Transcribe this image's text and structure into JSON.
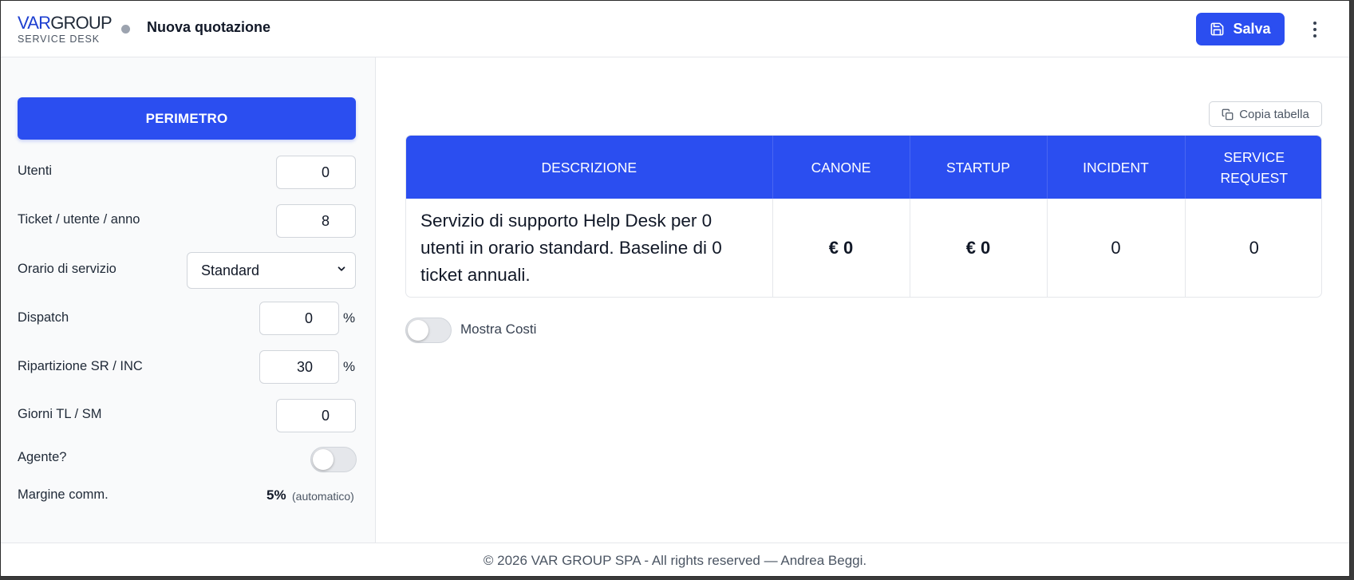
{
  "header": {
    "logo_var": "VAR",
    "logo_group": "GROUP",
    "logo_sub": "SERVICE DESK",
    "title": "Nuova quotazione",
    "save_label": "Salva"
  },
  "sidebar": {
    "section_button": "PERIMETRO",
    "fields": {
      "utenti": {
        "label": "Utenti",
        "value": "0"
      },
      "ticket": {
        "label": "Ticket / utente / anno",
        "value": "8"
      },
      "orario": {
        "label": "Orario di servizio",
        "value": "Standard"
      },
      "dispatch": {
        "label": "Dispatch",
        "value": "0",
        "unit": "%"
      },
      "ripartizione": {
        "label": "Ripartizione SR / INC",
        "value": "30",
        "unit": "%"
      },
      "giorni": {
        "label": "Giorni TL / SM",
        "value": "0"
      },
      "agente": {
        "label": "Agente?",
        "checked": false
      },
      "margine": {
        "label": "Margine comm.",
        "value": "5%",
        "note": "(automatico)"
      }
    }
  },
  "main": {
    "copy_label": "Copia tabella",
    "table": {
      "headers": [
        "DESCRIZIONE",
        "CANONE",
        "STARTUP",
        "INCIDENT",
        "SERVICE REQUEST"
      ],
      "row": {
        "descrizione": "Servizio di supporto Help Desk per 0 utenti in orario standard. Baseline di 0 ticket annuali.",
        "canone": "€ 0",
        "startup": "€ 0",
        "incident": "0",
        "service_request": "0"
      }
    },
    "mostra_costi": {
      "label": "Mostra Costi",
      "checked": false
    }
  },
  "footer": {
    "text": "© 2026 VAR GROUP SPA - All rights reserved — Andrea Beggi."
  },
  "colors": {
    "accent": "#2b4ef0",
    "brand_blue": "#1d3fd0"
  }
}
